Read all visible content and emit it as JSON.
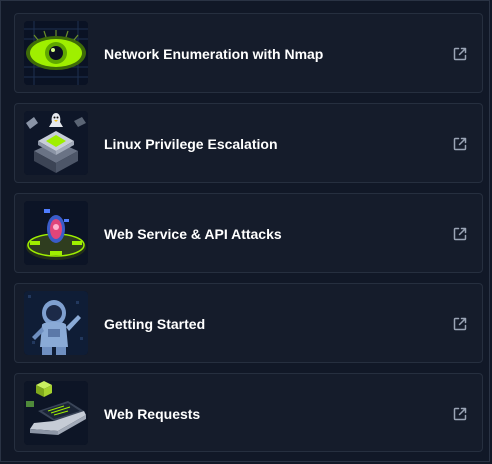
{
  "modules": [
    {
      "title": "Network Enumeration with Nmap",
      "thumbnail": "green-eye-icon",
      "action_icon": "external-link-icon"
    },
    {
      "title": "Linux Privilege Escalation",
      "thumbnail": "linux-server-stack-icon",
      "action_icon": "external-link-icon"
    },
    {
      "title": "Web Service & API Attacks",
      "thumbnail": "web-shield-platform-icon",
      "action_icon": "external-link-icon"
    },
    {
      "title": "Getting Started",
      "thumbnail": "astronaut-icon",
      "action_icon": "external-link-icon"
    },
    {
      "title": "Web Requests",
      "thumbnail": "laptop-cube-icon",
      "action_icon": "external-link-icon"
    }
  ],
  "colors": {
    "background": "#111827",
    "card": "#151c2b",
    "border": "#262f3f",
    "title": "#ffffff",
    "icon": "#9aa4b5",
    "accent": "#9fef00"
  }
}
